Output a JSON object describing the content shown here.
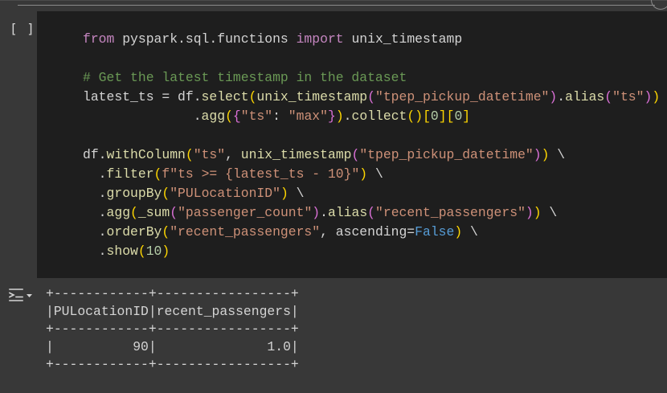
{
  "cell": {
    "run_indicator": "[ ]",
    "code_lines": [
      "from pyspark.sql.functions import unix_timestamp",
      "",
      "# Get the latest timestamp in the dataset",
      "latest_ts = df.select(unix_timestamp(\"tpep_pickup_datetime\").alias(\"ts\")) \\",
      "              .agg({\"ts\": \"max\"}).collect()[0][0]",
      "",
      "df.withColumn(\"ts\", unix_timestamp(\"tpep_pickup_datetime\")) \\",
      "  .filter(f\"ts >= {latest_ts - 10}\") \\",
      "  .groupBy(\"PULocationID\") \\",
      "  .agg(_sum(\"passenger_count\").alias(\"recent_passengers\")) \\",
      "  .orderBy(\"recent_passengers\", ascending=False) \\",
      "  .show(10)"
    ]
  },
  "output": {
    "icon": "output-toggle-icon",
    "table": {
      "border": "+------------+-----------------+",
      "header": "|PULocationID|recent_passengers|",
      "rows": [
        "|          90|              1.0|"
      ]
    }
  },
  "colors": {
    "code_bg": "#1e1e1e",
    "cell_bg": "#383838",
    "keyword": "#c586c0",
    "comment": "#6a9955",
    "string": "#ce9178",
    "number": "#b5cea8",
    "builtin": "#569cd6"
  }
}
